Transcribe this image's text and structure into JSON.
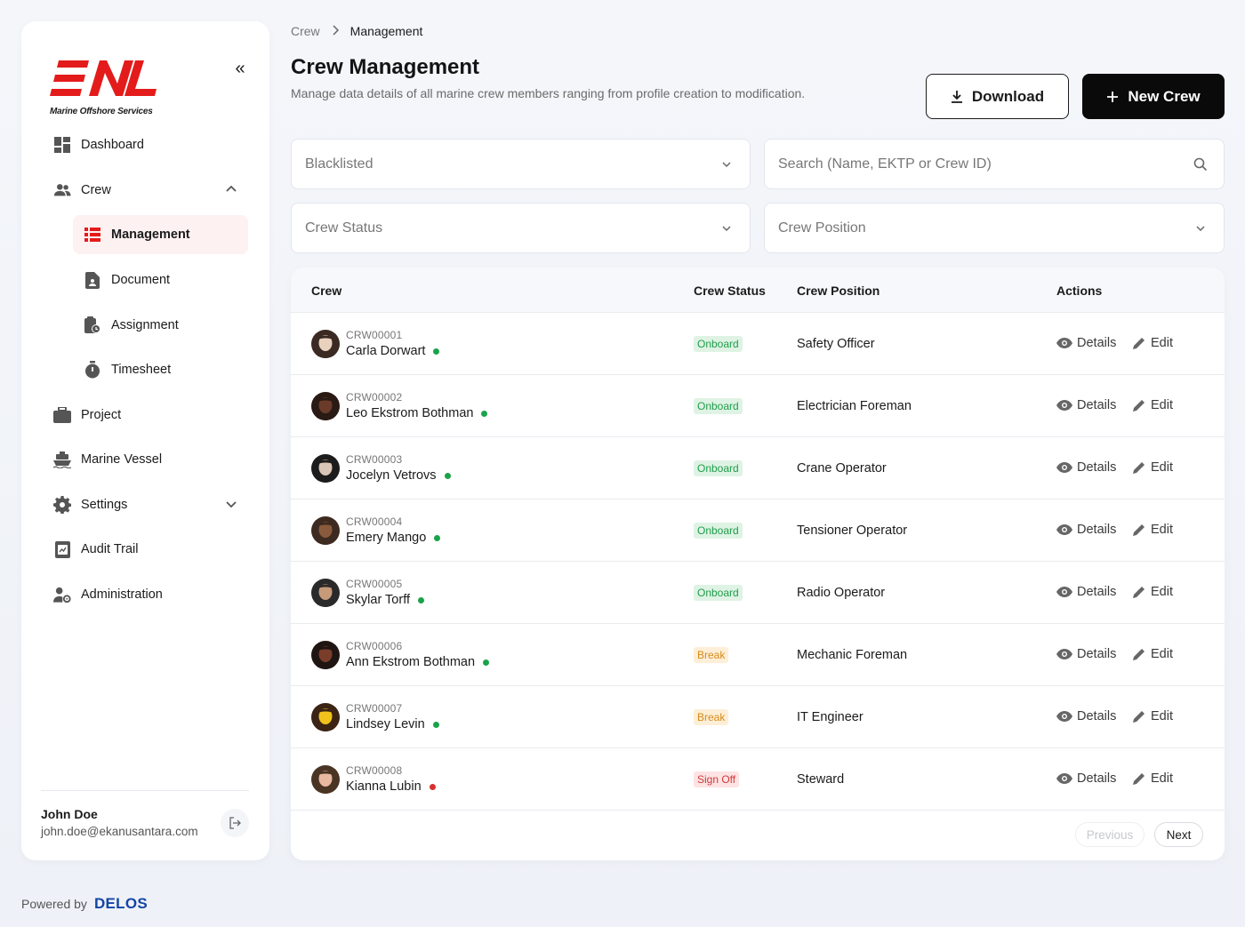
{
  "sidebar": {
    "logo_text": "ENL",
    "logo_subtitle": "Marine Offshore Services",
    "nav": {
      "dashboard": "Dashboard",
      "crew": "Crew",
      "management": "Management",
      "document": "Document",
      "assignment": "Assignment",
      "timesheet": "Timesheet",
      "project": "Project",
      "marine_vessel": "Marine Vessel",
      "settings": "Settings",
      "audit_trail": "Audit Trail",
      "administration": "Administration"
    },
    "user": {
      "name": "John Doe",
      "email": "john.doe@ekanusantara.com"
    }
  },
  "footer": {
    "powered_by": "Powered by",
    "brand": "DELOS"
  },
  "breadcrumb": {
    "parent": "Crew",
    "current": "Management"
  },
  "header": {
    "title": "Crew Management",
    "description": "Manage data details of all marine crew members ranging from profile creation to modification.",
    "download_label": "Download",
    "new_crew_label": "New Crew"
  },
  "filters": {
    "blacklisted": "Blacklisted",
    "search_placeholder": "Search (Name, EKTP or Crew ID)",
    "crew_status": "Crew Status",
    "crew_position": "Crew Position"
  },
  "table": {
    "columns": {
      "crew": "Crew",
      "status": "Crew Status",
      "position": "Crew Position",
      "actions": "Actions"
    },
    "action_labels": {
      "details": "Details",
      "edit": "Edit"
    },
    "rows": [
      {
        "id": "CRW00001",
        "name": "Carla Dorwart",
        "status": "Onboard",
        "status_kind": "onboard",
        "position": "Safety Officer",
        "presence": "#1aa34a"
      },
      {
        "id": "CRW00002",
        "name": "Leo Ekstrom Bothman",
        "status": "Onboard",
        "status_kind": "onboard",
        "position": "Electrician Foreman",
        "presence": "#1aa34a"
      },
      {
        "id": "CRW00003",
        "name": "Jocelyn Vetrovs",
        "status": "Onboard",
        "status_kind": "onboard",
        "position": "Crane Operator",
        "presence": "#1aa34a"
      },
      {
        "id": "CRW00004",
        "name": "Emery Mango",
        "status": "Onboard",
        "status_kind": "onboard",
        "position": "Tensioner Operator",
        "presence": "#1aa34a"
      },
      {
        "id": "CRW00005",
        "name": "Skylar Torff",
        "status": "Onboard",
        "status_kind": "onboard",
        "position": "Radio Operator",
        "presence": "#1aa34a"
      },
      {
        "id": "CRW00006",
        "name": "Ann Ekstrom Bothman",
        "status": "Break",
        "status_kind": "break",
        "position": "Mechanic Foreman",
        "presence": "#1aa34a"
      },
      {
        "id": "CRW00007",
        "name": "Lindsey Levin",
        "status": "Break",
        "status_kind": "break",
        "position": "IT Engineer",
        "presence": "#1aa34a"
      },
      {
        "id": "CRW00008",
        "name": "Kianna Lubin",
        "status": "Sign Off",
        "status_kind": "signoff",
        "position": "Steward",
        "presence": "#d8302f"
      }
    ]
  },
  "pagination": {
    "previous": "Previous",
    "next": "Next"
  },
  "colors": {
    "brand_red": "#e41b1b",
    "accent_dark": "#0a0a0a",
    "delos_blue": "#1345a6"
  }
}
